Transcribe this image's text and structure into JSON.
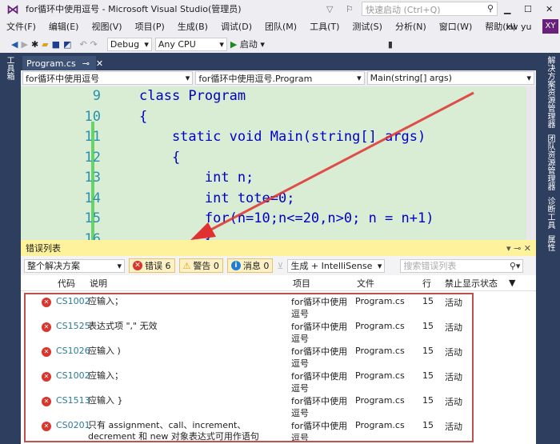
{
  "title": "for循环中使用逗号 - Microsoft Visual Studio(管理员)",
  "quick_launch_placeholder": "快速启动 (Ctrl+Q)",
  "menu": [
    "文件(F)",
    "编辑(E)",
    "视图(V)",
    "项目(P)",
    "生成(B)",
    "调试(D)",
    "团队(M)",
    "工具(T)",
    "测试(S)",
    "分析(N)",
    "窗口(W)",
    "帮助(H)"
  ],
  "user": {
    "name": "xw yu",
    "initials": "XY"
  },
  "toolbar": {
    "config": "Debug",
    "platform": "Any CPU",
    "start": "启动"
  },
  "left_tool": "工具箱",
  "right_tools": [
    "解决方案资源管理器",
    "团队资源管理器",
    "诊断工具",
    "属性"
  ],
  "tab": {
    "name": "Program.cs"
  },
  "nav": {
    "project": "for循环中使用逗号",
    "class": "for循环中使用逗号.Program",
    "member": "Main(string[] args)"
  },
  "code": [
    {
      "n": "9",
      "t": "class Program"
    },
    {
      "n": "10",
      "t": "{"
    },
    {
      "n": "11",
      "t": "    static void Main(string[] args)"
    },
    {
      "n": "12",
      "t": "    {"
    },
    {
      "n": "13",
      "t": "        int n;"
    },
    {
      "n": "14",
      "t": "        int tote=0;"
    },
    {
      "n": "15",
      "t": "        for(n=10;n<=20,n>0; n = n+1)"
    },
    {
      "n": "16",
      "t": "        {"
    }
  ],
  "errors_panel": {
    "title": "错误列表",
    "scope": "整个解决方案",
    "errors_label": "错误 6",
    "warnings_label": "警告 0",
    "messages_label": "消息 0",
    "source": "生成 + IntelliSense",
    "search_placeholder": "搜索错误列表",
    "columns": [
      "代码",
      "说明",
      "项目",
      "文件",
      "行",
      "禁止显示状态"
    ],
    "rows": [
      {
        "code": "CS1002",
        "desc": "应输入；",
        "project": "for循环中使用逗号",
        "file": "Program.cs",
        "line": "15",
        "state": "活动"
      },
      {
        "code": "CS1525",
        "desc": "表达式项 \",\" 无效",
        "project": "for循环中使用逗号",
        "file": "Program.cs",
        "line": "15",
        "state": "活动"
      },
      {
        "code": "CS1026",
        "desc": "应输入 )",
        "project": "for循环中使用逗号",
        "file": "Program.cs",
        "line": "15",
        "state": "活动"
      },
      {
        "code": "CS1002",
        "desc": "应输入；",
        "project": "for循环中使用逗号",
        "file": "Program.cs",
        "line": "15",
        "state": "活动"
      },
      {
        "code": "CS1513",
        "desc": "应输入 }",
        "project": "for循环中使用逗号",
        "file": "Program.cs",
        "line": "15",
        "state": "活动"
      },
      {
        "code": "CS0201",
        "desc": "只有 assignment、call、increment、decrement 和 new 对象表达式可用作语句",
        "project": "for循环中使用逗号",
        "file": "Program.cs",
        "line": "15",
        "state": "活动"
      }
    ]
  }
}
